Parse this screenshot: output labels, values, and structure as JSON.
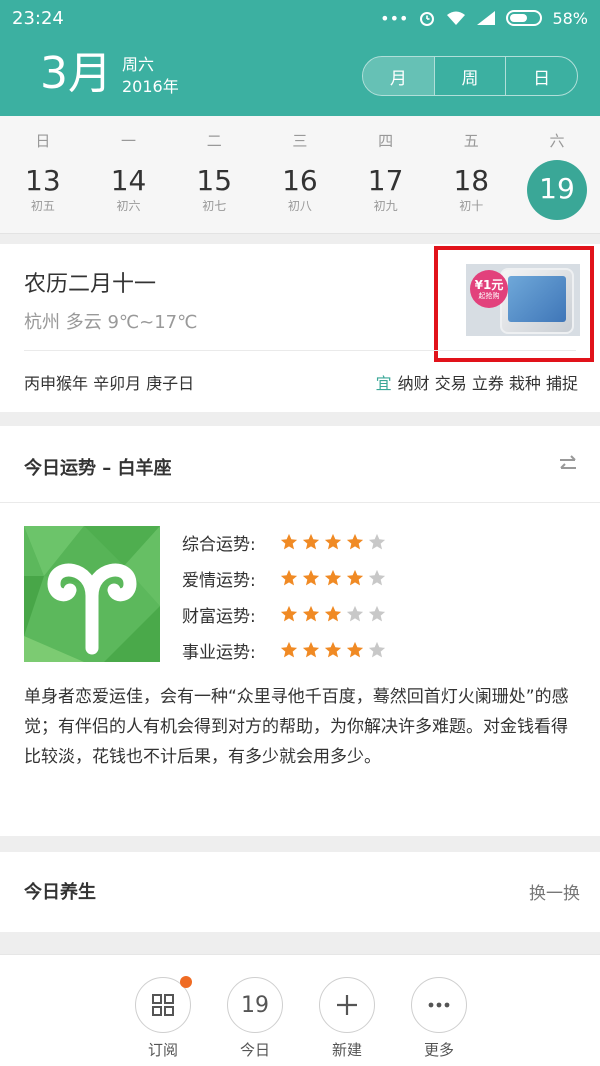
{
  "status_bar": {
    "time": "23:24",
    "battery": "58%",
    "icons": [
      "dots-icon",
      "alarm-icon",
      "wifi-icon",
      "signal-icon",
      "battery-icon"
    ]
  },
  "header": {
    "month": "3月",
    "weekday": "周六",
    "year": "2016年",
    "views": [
      "月",
      "周",
      "日"
    ],
    "active_view": "月",
    "color": "#3cb0a1"
  },
  "week": {
    "weekdays": [
      "日",
      "一",
      "二",
      "三",
      "四",
      "五",
      "六"
    ],
    "days": [
      {
        "num": "13",
        "lunar": "初五"
      },
      {
        "num": "14",
        "lunar": "初六"
      },
      {
        "num": "15",
        "lunar": "初七"
      },
      {
        "num": "16",
        "lunar": "初八"
      },
      {
        "num": "17",
        "lunar": "初九"
      },
      {
        "num": "18",
        "lunar": "初十"
      },
      {
        "num": "19",
        "lunar": ""
      }
    ],
    "selected": "19"
  },
  "lunar": {
    "title": "农历二月十一",
    "weather": "杭州  多云  9℃~17℃",
    "ganzhi": "丙申猴年  辛卯月  庚子日",
    "yi_label": "宜",
    "yi_items": "纳财 交易 立券 栽种 捕捉",
    "ad": {
      "badge_main": "¥1元",
      "badge_sub": "起抢购"
    }
  },
  "fortune": {
    "title": "今日运势 – 白羊座",
    "ratings": [
      {
        "label": "综合运势:",
        "stars": 4
      },
      {
        "label": "爱情运势:",
        "stars": 4
      },
      {
        "label": "财富运势:",
        "stars": 3
      },
      {
        "label": "事业运势:",
        "stars": 4
      }
    ],
    "max_stars": 5,
    "text": "单身者恋爱运佳，会有一种“众里寻他千百度，蓦然回首灯火阑珊处”的感觉；有伴侣的人有机会得到对方的帮助，为你解决许多难题。对金钱看得比较淡，花钱也不计后果，有多少就会用多少。",
    "star_color": "#f08a24",
    "star_off_color": "#c8c8c8"
  },
  "health": {
    "title": "今日养生",
    "refresh": "换一换"
  },
  "toolbar": {
    "subscribe": "订阅",
    "today": "今日",
    "today_num": "19",
    "new": "新建",
    "more": "更多"
  }
}
